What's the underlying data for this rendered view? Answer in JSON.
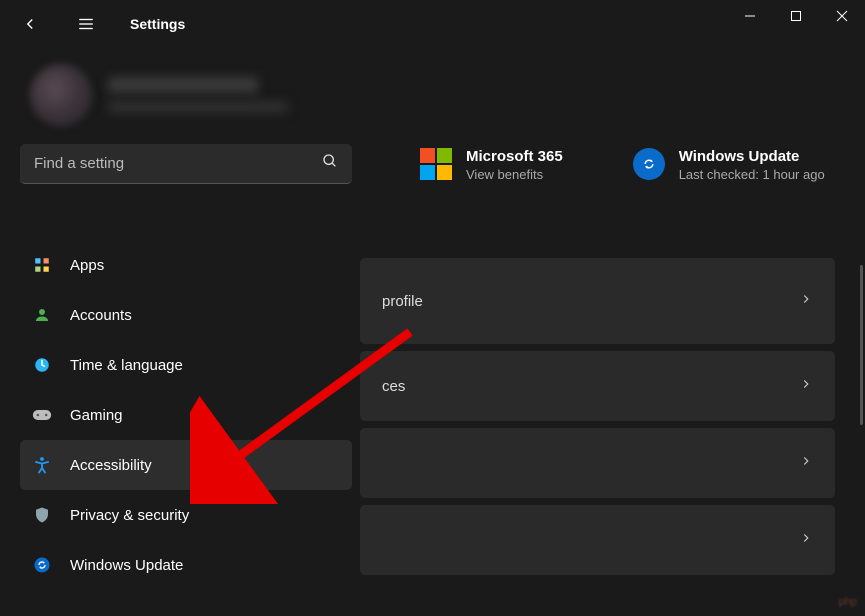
{
  "window": {
    "title": "Settings"
  },
  "search": {
    "placeholder": "Find a setting"
  },
  "nav": {
    "items": [
      {
        "label": "Apps"
      },
      {
        "label": "Accounts"
      },
      {
        "label": "Time & language"
      },
      {
        "label": "Gaming"
      },
      {
        "label": "Accessibility"
      },
      {
        "label": "Privacy & security"
      },
      {
        "label": "Windows Update"
      }
    ]
  },
  "promo": {
    "m365": {
      "title": "Microsoft 365",
      "subtitle": "View benefits"
    },
    "update": {
      "title": "Windows Update",
      "subtitle": "Last checked: 1 hour ago"
    }
  },
  "rows": {
    "r0": " profile",
    "r1": "ces",
    "r2": "",
    "r3": ""
  },
  "watermark": "php"
}
